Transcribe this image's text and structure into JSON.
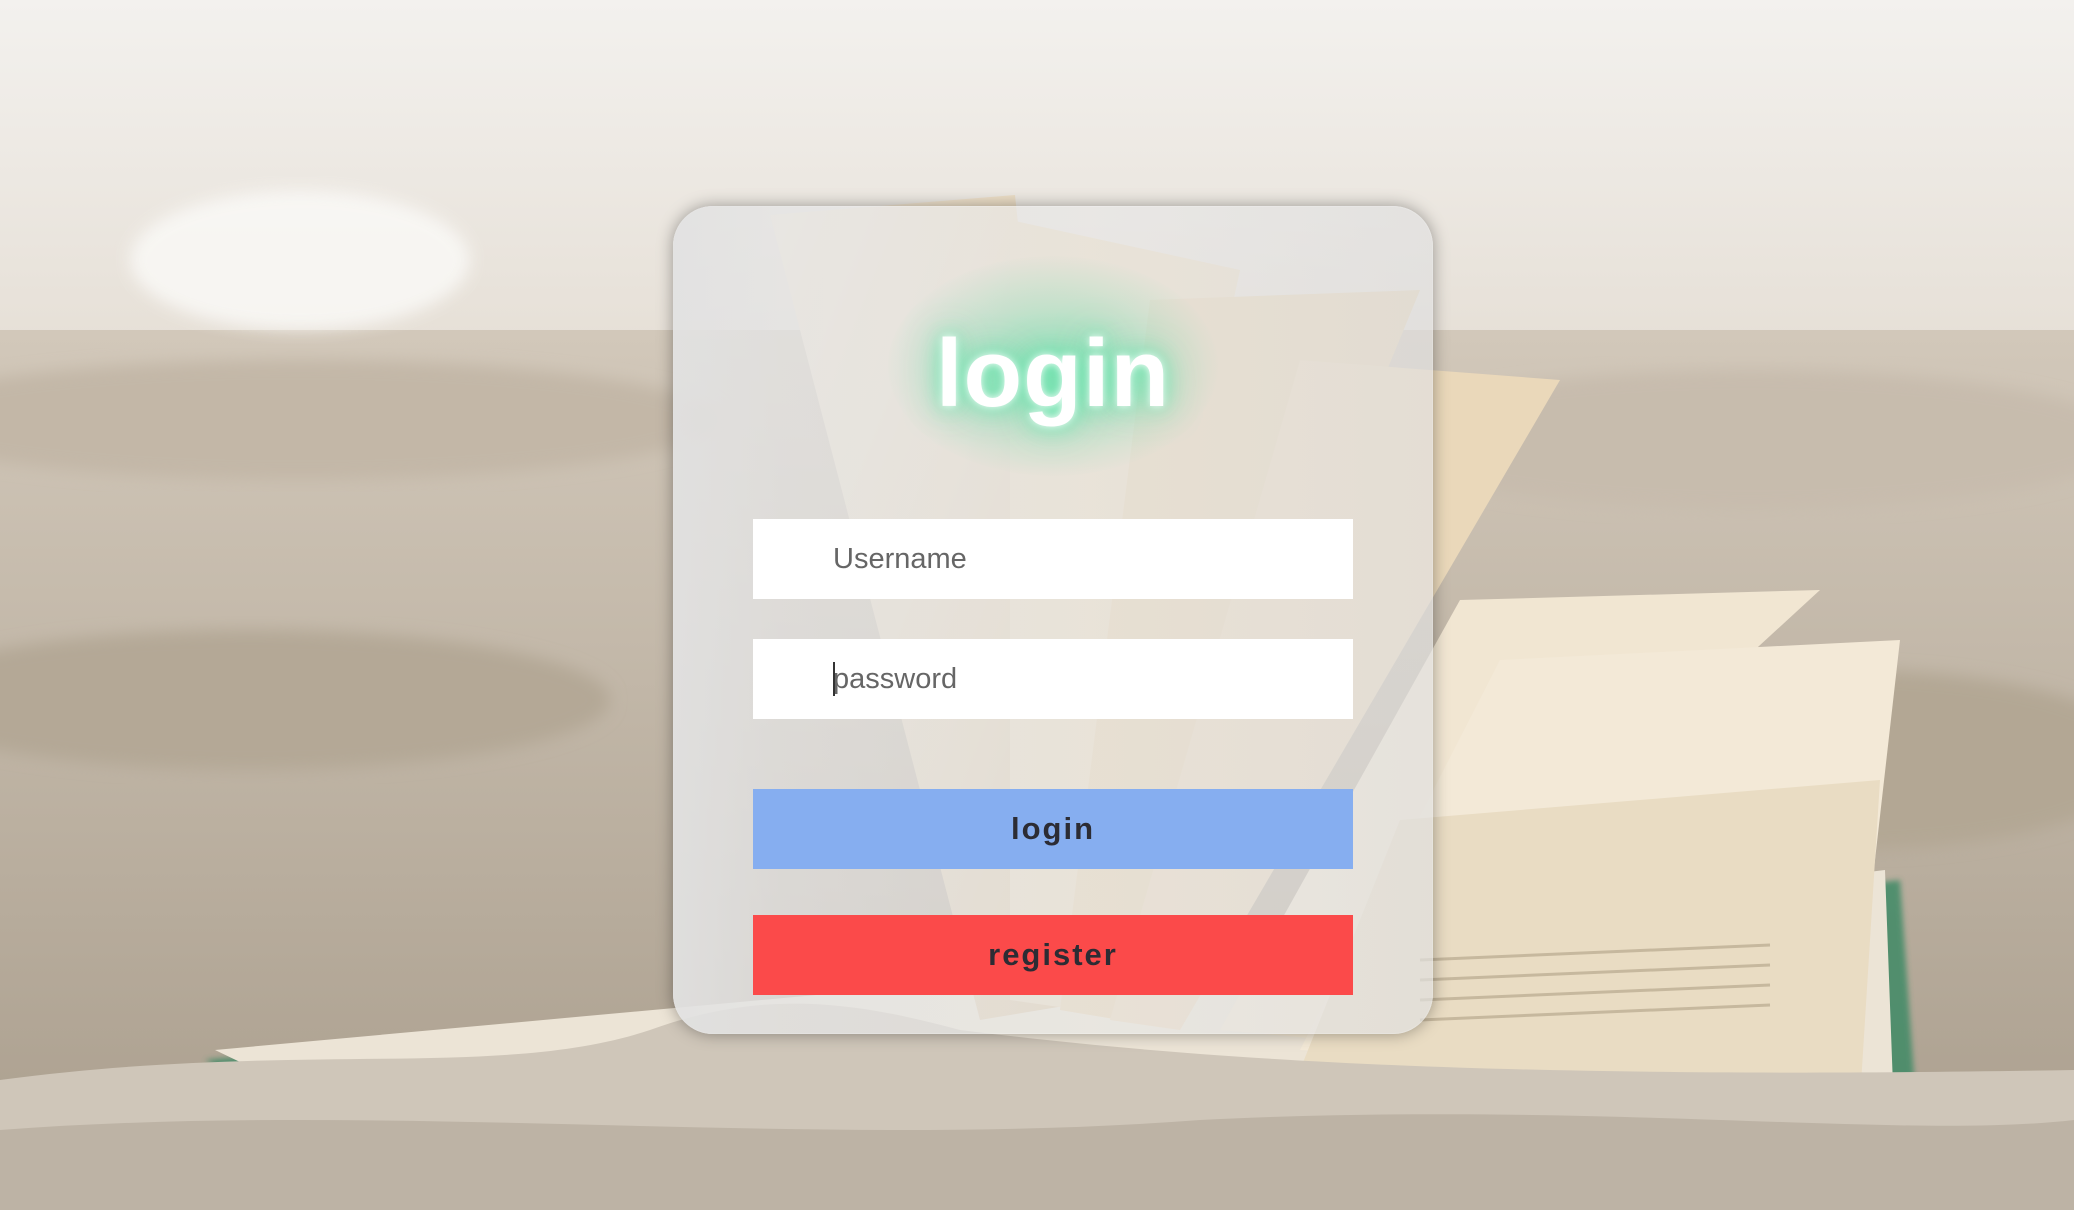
{
  "form": {
    "title": "login",
    "username_placeholder": "Username",
    "password_placeholder": "password",
    "login_button": "login",
    "register_button": "register"
  },
  "colors": {
    "login_button": "#86aef0",
    "register_button": "#fb4a4a",
    "title_glow": "#5fdca8",
    "card": "rgba(235,235,235,0.55)"
  }
}
